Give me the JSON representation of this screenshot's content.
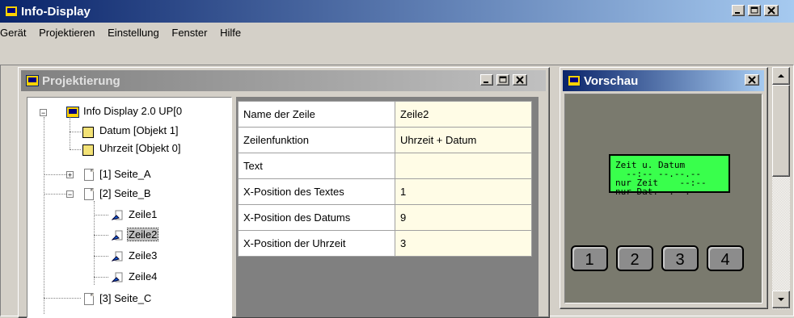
{
  "app": {
    "title": "Info-Display"
  },
  "menu": [
    "Gerät",
    "Projektieren",
    "Einstellung",
    "Fenster",
    "Hilfe"
  ],
  "projektierung": {
    "title": "Projektierung",
    "tree": {
      "root": "Info Display 2.0 UP[0",
      "items": [
        {
          "label": "Datum [Objekt 1]"
        },
        {
          "label": "Uhrzeit [Objekt 0]"
        },
        {
          "label": "[1] Seite_A"
        },
        {
          "label": "[2] Seite_B"
        },
        {
          "label": "Zeile1"
        },
        {
          "label": "Zeile2"
        },
        {
          "label": "Zeile3"
        },
        {
          "label": "Zeile4"
        },
        {
          "label": "[3] Seite_C"
        }
      ]
    },
    "properties": [
      {
        "name": "Name der Zeile",
        "value": "Zeile2"
      },
      {
        "name": "Zeilenfunktion",
        "value": "Uhrzeit + Datum"
      },
      {
        "name": "Text",
        "value": ""
      },
      {
        "name": "X-Position des Textes",
        "value": "1"
      },
      {
        "name": "X-Position des Datums",
        "value": "9"
      },
      {
        "name": "X-Position der Uhrzeit",
        "value": "3"
      }
    ]
  },
  "vorschau": {
    "title": "Vorschau",
    "lcd_lines": [
      "Zeit u. Datum",
      "  --:-- --.--.--",
      "nur Zeit    --:--",
      "nur Dat.--.--.--"
    ],
    "buttons": [
      "1",
      "2",
      "3",
      "4"
    ]
  },
  "colors": {
    "active_title": "#0a246a",
    "lcd_green": "#39ff4c",
    "value_cell": "#fffce6"
  }
}
